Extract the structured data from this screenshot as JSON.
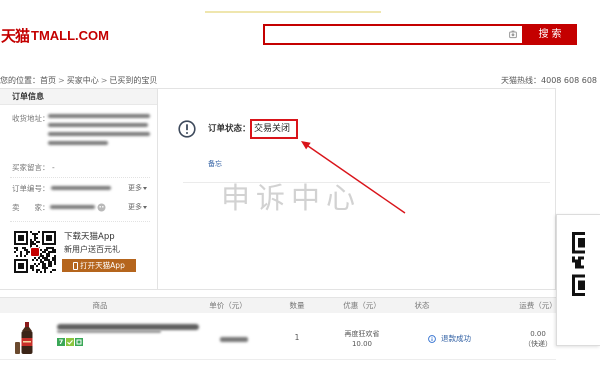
{
  "logo": {
    "cn": "天猫",
    "en": "TMALL.COM"
  },
  "search": {
    "value": "",
    "button_label": "搜索",
    "icon": "camera-icon"
  },
  "breadcrumb": {
    "prefix": "您的位置：",
    "items": [
      "首页",
      "买家中心",
      "已买到的宝贝"
    ],
    "separator": ">"
  },
  "hotline": "天猫热线：4008 608 608",
  "order_info": {
    "header": "订单信息",
    "address_label": "收货地址：",
    "message_label": "买家留言：",
    "message_value": "-",
    "order_no_label": "订单编号：",
    "order_no_more": "更多",
    "seller_label": "卖　　家：",
    "seller_more": "更多"
  },
  "app_promo": {
    "line1": "下载天猫App",
    "line2": "新用户送百元礼",
    "button_label": "打开天猫App"
  },
  "order_status": {
    "label": "订单状态：",
    "value": "交易关闭",
    "memo_link": "备忘"
  },
  "watermark": "申诉中心",
  "items_table": {
    "columns": [
      "商品",
      "单价（元）",
      "数量",
      "优惠（元）",
      "状态",
      "运费（元）"
    ],
    "rows": [
      {
        "service_badge": "7",
        "quantity": "1",
        "discount_label": "再度狂欢省",
        "discount_amount": "10.00",
        "status": "退款成功",
        "shipping_fee": "0.00",
        "shipping_method": "（快递）"
      }
    ]
  },
  "colors": {
    "brand_red": "#c40000",
    "annotation_red": "#d9141a",
    "promo_button": "#b5651d",
    "link_blue": "#2f5fa3",
    "badge_green": "#3aa757"
  }
}
